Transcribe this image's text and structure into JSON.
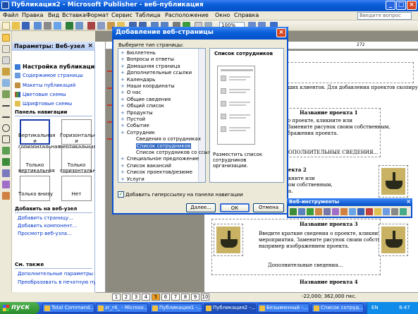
{
  "window": {
    "title": "Публикация2 - Microsoft Publisher - веб-публикация"
  },
  "menu": {
    "items": [
      "Файл",
      "Правка",
      "Вид",
      "Вставка",
      "Формат",
      "Сервис",
      "Таблица",
      "Расположение",
      "Окно",
      "Справка"
    ],
    "help_placeholder": "Введите вопрос"
  },
  "toolbar": {
    "zoom": "100%"
  },
  "taskpane": {
    "title": "Параметры: Веб-узел",
    "publication_settings": "Настройка публикации",
    "links": [
      "Содержимое страницы",
      "Макеты публикаций",
      "Цветовые схемы",
      "Шрифтовые схемы"
    ],
    "nav_panel_title": "Панель навигации",
    "nav_options": [
      "Вертикальная и горизонтальная",
      "Горизонтальная и вертикальная",
      "Только вертикальная",
      "Только горизонтальная",
      "Только внизу",
      "Нет"
    ],
    "add_title": "Добавить на веб-узел",
    "add_links": [
      "Добавить страницу...",
      "Добавить компонент...",
      "Просмотр веб-узла..."
    ],
    "see_also_title": "См. также",
    "see_also_links": [
      "Дополнительные параметры веб-узла",
      "Преобразовать в печатную публикацию"
    ]
  },
  "ruler": {
    "marks": [
      "16",
      "272"
    ]
  },
  "page": {
    "intro_text": "ших клиентов. Для добавления проектов скопируйте к",
    "project1": {
      "title": "Название проекта 1",
      "lines": [
        "о проекте, кликните или",
        "Замените рисунок своим собственным,",
        "бражения проекта."
      ],
      "more": "ОПОЛНИТЕЛЬНЫЕ СВЕДЕНИЯ..."
    },
    "project2": {
      "title": "екта 2",
      "lines": [
        "кните или",
        "ом собственным,",
        "а."
      ]
    },
    "project3": {
      "title": "Название проекта 3",
      "lines": [
        "Введите краткие сведения о проекте, кликните или",
        "мероприятия. Замените рисунок своим собственным,",
        "например изображением проекта."
      ],
      "more": "Дополнительные сведения..."
    },
    "project4": {
      "title": "Название проекта 4"
    }
  },
  "dialog": {
    "title": "Добавление веб-страницы",
    "prompt": "Выберите тип страницы:",
    "items": [
      {
        "text": "Бюллетень",
        "sub": false
      },
      {
        "text": "Вопросы и ответы",
        "sub": false
      },
      {
        "text": "Домашняя страница",
        "sub": false
      },
      {
        "text": "Дополнительные ссылки",
        "sub": false
      },
      {
        "text": "Календарь",
        "sub": false
      },
      {
        "text": "Наши координаты",
        "sub": false
      },
      {
        "text": "О нас",
        "sub": false
      },
      {
        "text": "Общие сведения",
        "sub": false
      },
      {
        "text": "Общий список",
        "sub": false
      },
      {
        "text": "Продукты",
        "sub": false
      },
      {
        "text": "Пустой",
        "sub": false
      },
      {
        "text": "Событие",
        "sub": false
      },
      {
        "text": "Сотрудник",
        "sub": false
      },
      {
        "text": "Сведения о сотрудниках",
        "sub": true
      },
      {
        "text": "Список сотрудников",
        "sub": true,
        "selected": true
      },
      {
        "text": "Список сотрудников со ссылк",
        "sub": true
      },
      {
        "text": "Специальное предложение",
        "sub": false
      },
      {
        "text": "Список вакансий",
        "sub": false
      },
      {
        "text": "Список проектов/резюме",
        "sub": false
      },
      {
        "text": "Услуги",
        "sub": false
      }
    ],
    "preview_title": "Список сотрудников",
    "preview_description": "Разместить список сотрудников организации.",
    "checkbox_label": "Добавить гиперссылку на панели навигации",
    "checkbox_checked": true,
    "buttons": {
      "more": "Далее...",
      "ok": "ОК",
      "cancel": "Отмена"
    }
  },
  "web_toolbar": {
    "title": "Веб-инструменты"
  },
  "page_tabs": {
    "pages": [
      "1",
      "2",
      "3",
      "4",
      "5",
      "6",
      "7",
      "8",
      "9",
      "10"
    ],
    "active": "5"
  },
  "status": {
    "coords": "-22,000; 362,000 пкс."
  },
  "taskbar": {
    "start": "пуск",
    "tasks": [
      "Total Command...",
      "zr_r4_ - Microso...",
      "Публикация1 -...",
      "Публикация2 -...",
      "Безымянный -...",
      "Список сотруд..."
    ],
    "active_task": 3,
    "lang": "EN",
    "clock": "8:47"
  },
  "colors": {
    "accent": "#0a5fd8",
    "selection": "#316ac5",
    "active_tab": "#f3a020"
  }
}
